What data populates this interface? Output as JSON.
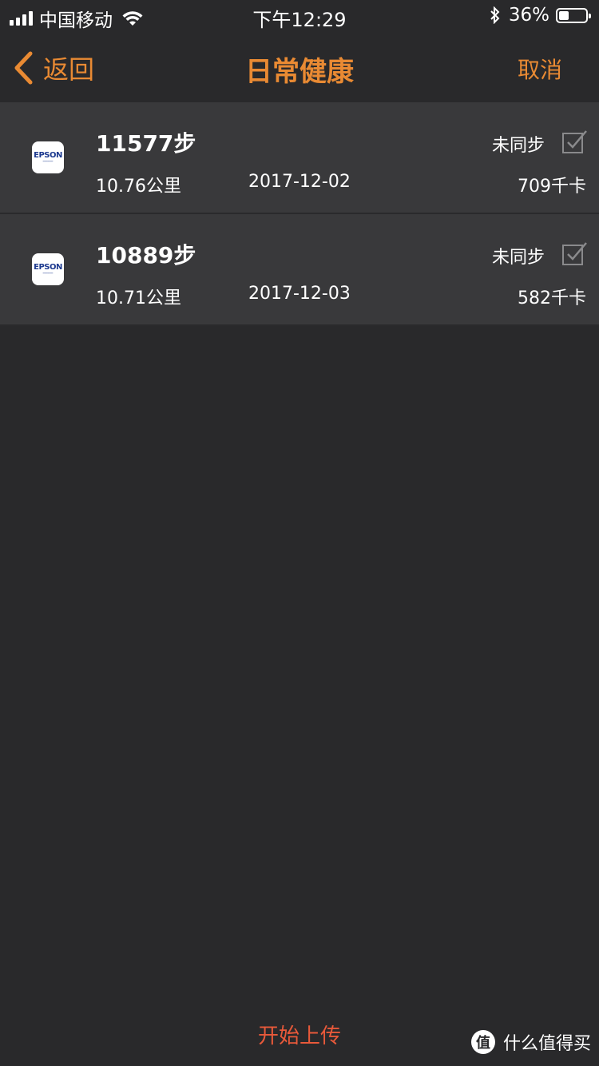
{
  "status_bar": {
    "carrier": "中国移动",
    "time": "下午12:29",
    "battery_pct": "36%",
    "battery_level": 0.36
  },
  "nav": {
    "back_label": "返回",
    "title": "日常健康",
    "cancel_label": "取消"
  },
  "records": [
    {
      "app_logo": "EPSON",
      "steps": "11577步",
      "sync_status": "未同步",
      "distance": "10.76公里",
      "date": "2017-12-02",
      "calories": "709千卡",
      "checked": true
    },
    {
      "app_logo": "EPSON",
      "steps": "10889步",
      "sync_status": "未同步",
      "distance": "10.71公里",
      "date": "2017-12-03",
      "calories": "582千卡",
      "checked": true
    }
  ],
  "footer": {
    "upload_label": "开始上传"
  },
  "watermark": {
    "badge": "值",
    "text": "什么值得买"
  },
  "colors": {
    "accent": "#e98a33",
    "upload": "#e8593a",
    "background": "#29292b",
    "row": "#39393b"
  }
}
